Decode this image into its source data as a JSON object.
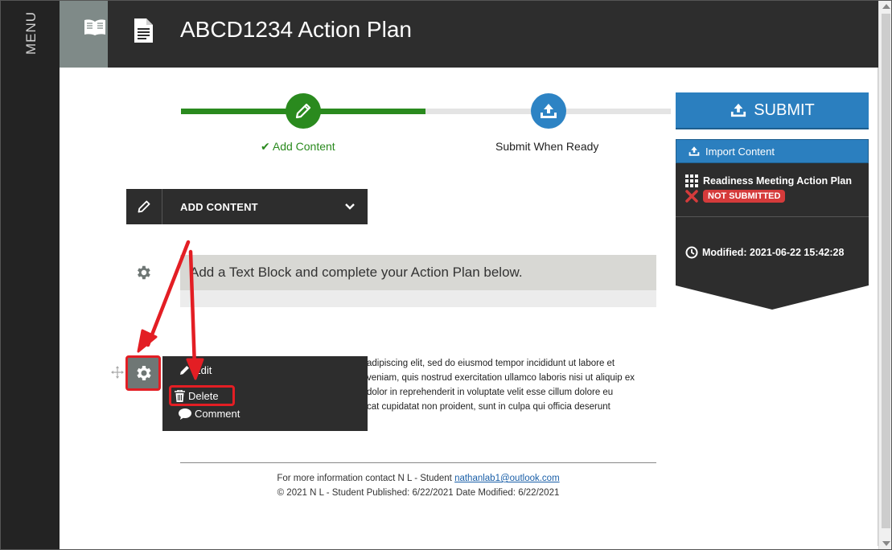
{
  "sidebar": {
    "menu_label": "MENU"
  },
  "header": {
    "title": "ABCD1234 Action Plan"
  },
  "steps": [
    {
      "label": "Add Content",
      "state": "complete"
    },
    {
      "label": "Submit When Ready",
      "state": "pending"
    }
  ],
  "submit": {
    "label": "SUBMIT"
  },
  "import": {
    "label": "Import Content",
    "item_title": "Readiness Meeting Action Plan",
    "status": "NOT SUBMITTED",
    "modified": "Modified: 2021-06-22 15:42:28"
  },
  "add_content": {
    "label": "ADD CONTENT"
  },
  "text_block": {
    "heading": "Add a Text Block and complete your Action Plan below."
  },
  "context_menu": {
    "edit": "Edit",
    "delete": "Delete",
    "comment": "Comment"
  },
  "lorem": {
    "line1": "adipiscing elit, sed do eiusmod tempor incididunt ut labore et",
    "line2": "veniam, quis nostrud exercitation ullamco laboris nisi ut aliquip ex",
    "line3": "dolor in reprehenderit in voluptate velit esse cillum dolore eu",
    "line4": "cat cupidatat non proident, sunt in culpa qui officia deserunt"
  },
  "footer": {
    "contact_prefix": "For more information contact N L - Student",
    "email": "nathanlab1@outlook.com",
    "copyright": "© 2021 N L - Student Published: 6/22/2021 Date Modified: 6/22/2021"
  },
  "colors": {
    "accent": "#2b7fbf",
    "success": "#2a8a1e",
    "danger": "#d53b3b",
    "annotation": "#e31e24",
    "dark": "#2d2d2d"
  }
}
